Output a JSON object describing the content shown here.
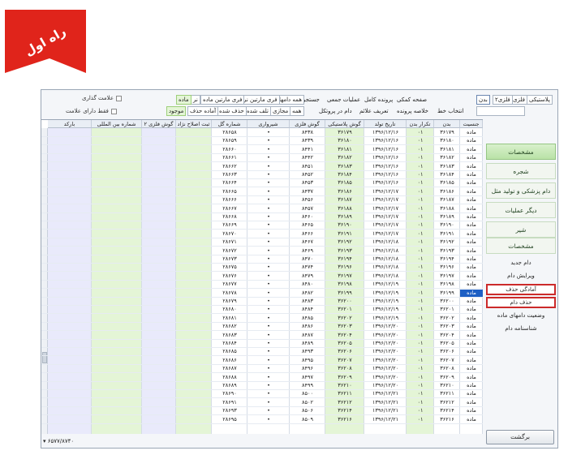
{
  "ribbon": {
    "text": "راه اول",
    "color": "#e0241b"
  },
  "toolbar": {
    "chk_mark": "علامت گذاری",
    "chk_only_marked": "فقط دارای علامت",
    "tabs_row1": [
      "پلاستیکی",
      "فلزی",
      "فلزی۲",
      "بدن"
    ],
    "search_label": "جستجو",
    "cmd_row1": [
      "صفحه کمکی",
      "پرونده کامل",
      "عملیات جمعی"
    ],
    "filter_row1": [
      "همه دامها",
      "فری مارتین نر",
      "فری مارتین ماده",
      "نر",
      "ماده"
    ],
    "cmd_row2": [
      "انتخاب خط",
      "خلاصه پرونده",
      "تعریف علائم",
      "دام در پروتکل"
    ],
    "filter_row2": [
      "همه",
      "مجازی",
      "تلف شده",
      "حذف شده",
      "آماده حذف",
      "موجود"
    ]
  },
  "grid": {
    "columns": [
      "جنسیت",
      "بدن",
      "تکرار بدن",
      "تاریخ تولد",
      "گوش پلاستیکی",
      "گوش فلزی",
      "شیرواری",
      "شماره گل",
      "ثبت اصلاح نژاد",
      "گوش فلزی ۲",
      "شماره بین المللی",
      "بارکد"
    ],
    "rows": [
      [
        "ماده",
        "۳۶۱۷۹",
        "۰۱",
        "۱۳۹۶/۱۲/۱۶",
        "۳۶۱۷۹",
        "۸۴۳۸",
        "•",
        "۲۸۶۵۸"
      ],
      [
        "ماده",
        "۳۶۱۸۰",
        "۰۱",
        "۱۳۹۶/۱۲/۱۶",
        "۳۶۱۸۰",
        "۸۴۳۹",
        "•",
        "۲۸۶۵۹"
      ],
      [
        "ماده",
        "۳۶۱۸۱",
        "۰۱",
        "۱۳۹۶/۱۲/۱۶",
        "۳۶۱۸۱",
        "۸۴۴۱",
        "•",
        "۲۸۶۶۰"
      ],
      [
        "ماده",
        "۳۶۱۸۲",
        "۰۱",
        "۱۳۹۶/۱۲/۱۶",
        "۳۶۱۸۲",
        "۸۴۴۲",
        "•",
        "۲۸۶۶۱"
      ],
      [
        "ماده",
        "۳۶۱۸۳",
        "۰۱",
        "۱۳۹۶/۱۲/۱۶",
        "۳۶۱۸۳",
        "۸۴۵۱",
        "•",
        "۲۸۶۶۲"
      ],
      [
        "ماده",
        "۳۶۱۸۴",
        "۰۱",
        "۱۳۹۶/۱۲/۱۶",
        "۳۶۱۸۴",
        "۸۴۵۲",
        "•",
        "۲۸۶۶۳"
      ],
      [
        "ماده",
        "۳۶۱۸۵",
        "۰۱",
        "۱۳۹۶/۱۲/۱۶",
        "۳۶۱۸۵",
        "۸۴۵۳",
        "•",
        "۲۸۶۶۴"
      ],
      [
        "ماده",
        "۳۶۱۸۶",
        "۰۱",
        "۱۳۹۶/۱۲/۱۷",
        "۳۶۱۸۶",
        "۸۴۳۷",
        "•",
        "۲۸۶۶۵"
      ],
      [
        "ماده",
        "۳۶۱۸۷",
        "۰۱",
        "۱۳۹۶/۱۲/۱۷",
        "۳۶۱۸۷",
        "۸۴۵۶",
        "•",
        "۲۸۶۶۶"
      ],
      [
        "ماده",
        "۳۶۱۸۸",
        "۰۱",
        "۱۳۹۶/۱۲/۱۷",
        "۳۶۱۸۸",
        "۸۴۵۷",
        "•",
        "۲۸۶۶۷"
      ],
      [
        "ماده",
        "۳۶۱۸۹",
        "۰۱",
        "۱۳۹۶/۱۲/۱۷",
        "۳۶۱۸۹",
        "۸۴۶۰",
        "•",
        "۲۸۶۶۸"
      ],
      [
        "ماده",
        "۳۶۱۹۰",
        "۰۱",
        "۱۳۹۶/۱۲/۱۷",
        "۳۶۱۹۰",
        "۸۴۶۵",
        "•",
        "۲۸۶۶۹"
      ],
      [
        "ماده",
        "۳۶۱۹۱",
        "۰۱",
        "۱۳۹۶/۱۲/۱۷",
        "۳۶۱۹۱",
        "۸۴۶۶",
        "•",
        "۲۸۶۷۰"
      ],
      [
        "ماده",
        "۳۶۱۹۲",
        "۰۱",
        "۱۳۹۶/۱۲/۱۸",
        "۳۶۱۹۲",
        "۸۴۶۷",
        "•",
        "۲۸۶۷۱"
      ],
      [
        "ماده",
        "۳۶۱۹۳",
        "۰۱",
        "۱۳۹۶/۱۲/۱۸",
        "۳۶۱۹۳",
        "۸۴۶۹",
        "•",
        "۲۸۶۷۲"
      ],
      [
        "ماده",
        "۳۶۱۹۴",
        "۰۱",
        "۱۳۹۶/۱۲/۱۸",
        "۳۶۱۹۴",
        "۸۴۷۰",
        "•",
        "۲۸۶۷۳"
      ],
      [
        "ماده",
        "۳۶۱۹۶",
        "۰۱",
        "۱۳۹۶/۱۲/۱۸",
        "۳۶۱۹۶",
        "۸۴۷۴",
        "•",
        "۲۸۶۷۵"
      ],
      [
        "ماده",
        "۳۶۱۹۷",
        "۰۱",
        "۱۳۹۶/۱۲/۱۸",
        "۳۶۱۹۷",
        "۸۴۷۹",
        "•",
        "۲۸۶۷۶"
      ],
      [
        "ماده",
        "۳۶۱۹۸",
        "۰۱",
        "۱۳۹۶/۱۲/۱۹",
        "۳۶۱۹۸",
        "۸۴۸۰",
        "•",
        "۲۸۶۷۷"
      ],
      [
        "ماده",
        "۳۶۱۹۹",
        "۰۱",
        "۱۳۹۶/۱۲/۱۹",
        "۳۶۱۹۹",
        "۸۴۸۲",
        "•",
        "۲۸۶۷۸"
      ],
      [
        "ماده",
        "۳۶۲۰۰",
        "۰۱",
        "۱۳۹۶/۱۲/۱۹",
        "۳۶۲۰۰",
        "۸۴۸۳",
        "•",
        "۲۸۶۷۹"
      ],
      [
        "ماده",
        "۳۶۲۰۱",
        "۰۱",
        "۱۳۹۶/۱۲/۱۹",
        "۳۶۲۰۱",
        "۸۴۸۴",
        "•",
        "۲۸۶۸۰"
      ],
      [
        "ماده",
        "۳۶۲۰۲",
        "۰۱",
        "۱۳۹۶/۱۲/۱۹",
        "۳۶۲۰۲",
        "۸۴۸۵",
        "•",
        "۲۸۶۸۱"
      ],
      [
        "ماده",
        "۳۶۲۰۳",
        "۰۱",
        "۱۳۹۶/۱۲/۲۰",
        "۳۶۲۰۳",
        "۸۴۸۶",
        "•",
        "۲۸۶۸۲"
      ],
      [
        "ماده",
        "۳۶۲۰۴",
        "۰۱",
        "۱۳۹۶/۱۲/۲۰",
        "۳۶۲۰۴",
        "۸۴۸۷",
        "•",
        "۲۸۶۸۳"
      ],
      [
        "ماده",
        "۳۶۲۰۵",
        "۰۱",
        "۱۳۹۶/۱۲/۲۰",
        "۳۶۲۰۵",
        "۸۴۸۹",
        "•",
        "۲۸۶۸۴"
      ],
      [
        "ماده",
        "۳۶۲۰۶",
        "۰۱",
        "۱۳۹۶/۱۲/۲۰",
        "۳۶۲۰۶",
        "۸۴۹۳",
        "•",
        "۲۸۶۸۵"
      ],
      [
        "ماده",
        "۳۶۲۰۷",
        "۰۱",
        "۱۳۹۶/۱۲/۲۰",
        "۳۶۲۰۷",
        "۸۴۹۵",
        "•",
        "۲۸۶۸۶"
      ],
      [
        "ماده",
        "۳۶۲۰۸",
        "۰۱",
        "۱۳۹۶/۱۲/۲۰",
        "۳۶۲۰۸",
        "۸۴۹۶",
        "•",
        "۲۸۶۸۷"
      ],
      [
        "ماده",
        "۳۶۲۰۹",
        "۰۱",
        "۱۳۹۶/۱۲/۲۰",
        "۳۶۲۰۹",
        "۸۴۹۷",
        "•",
        "۲۸۶۸۸"
      ],
      [
        "ماده",
        "۳۶۲۱۰",
        "۰۱",
        "۱۳۹۶/۱۲/۲۰",
        "۳۶۲۱۰",
        "۸۴۹۹",
        "•",
        "۲۸۶۸۹"
      ],
      [
        "ماده",
        "۳۶۲۱۱",
        "۰۱",
        "۱۳۹۶/۱۲/۲۱",
        "۳۶۲۱۱",
        "۸۵۰۰",
        "•",
        "۲۸۶۹۰"
      ],
      [
        "ماده",
        "۳۶۲۱۲",
        "۰۱",
        "۱۳۹۶/۱۲/۲۱",
        "۳۶۲۱۲",
        "۸۵۰۲",
        "•",
        "۲۸۶۹۱"
      ],
      [
        "ماده",
        "۳۶۲۱۴",
        "۰۱",
        "۱۳۹۶/۱۲/۲۱",
        "۳۶۲۱۴",
        "۸۵۰۶",
        "•",
        "۲۸۶۹۳"
      ],
      [
        "ماده",
        "۳۶۲۱۶",
        "۰۱",
        "۱۳۹۶/۱۲/۲۱",
        "۳۶۲۱۶",
        "۸۵۰۹",
        "•",
        "۲۸۶۹۵"
      ]
    ]
  },
  "panel": {
    "big_buttons": [
      "مشخصات",
      "شجره",
      "دام پزشکی و تولید مثل",
      "دیگر عملیات",
      "شیر",
      "مشخصات"
    ],
    "items": [
      "دام جدید",
      "ویرایش دام",
      "آمادگی حذف",
      "حذف دام",
      "وضعیت دامهای ماده",
      "شناسنامه دام"
    ]
  },
  "status": {
    "count": "۶۵۷۷/۸۷۴۰"
  },
  "footer": {
    "back_label": "برگشت"
  }
}
